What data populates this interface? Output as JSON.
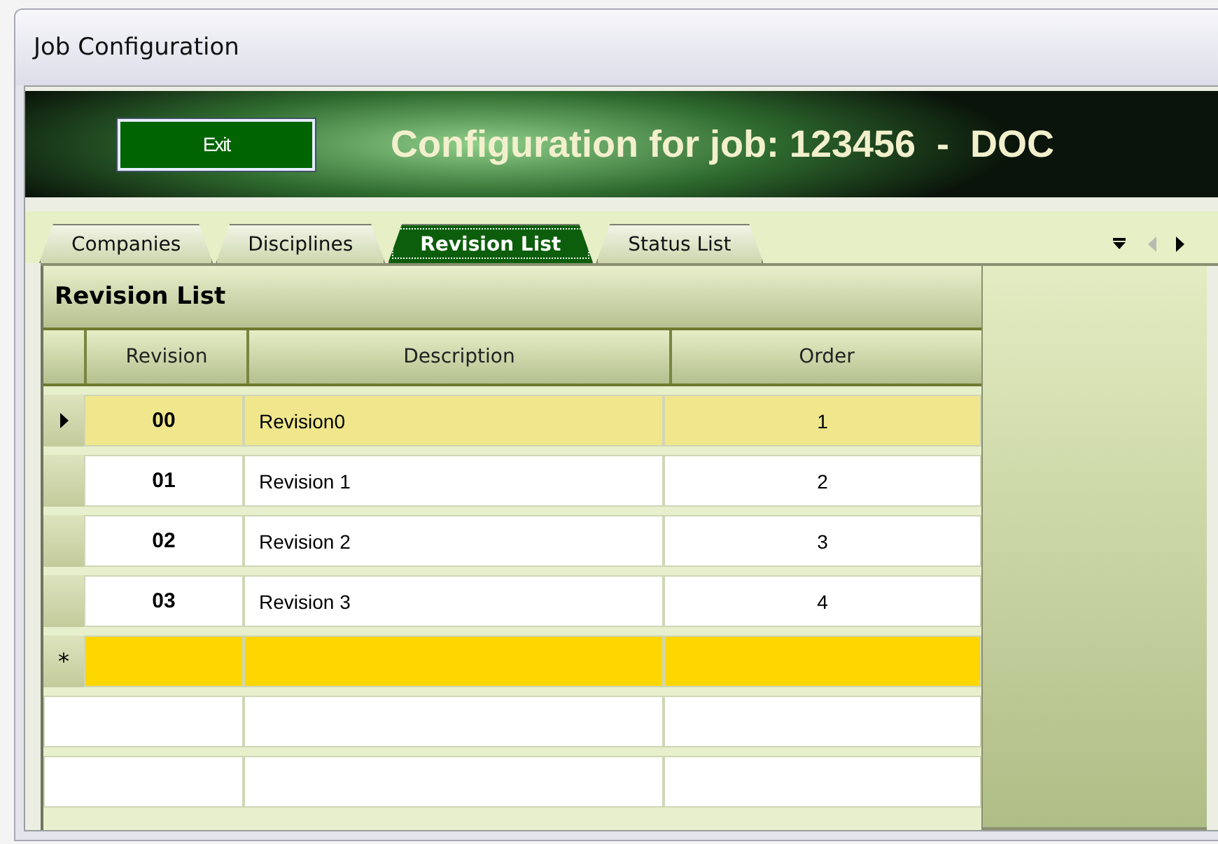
{
  "window": {
    "title": "Job Configuration"
  },
  "header": {
    "exit_button": "Exit",
    "title": "Configuration for job: 123456  -  DOC"
  },
  "tabs": [
    {
      "label": "Companies",
      "selected": false
    },
    {
      "label": "Disciplines",
      "selected": false
    },
    {
      "label": "Revision List",
      "selected": true
    },
    {
      "label": "Status List",
      "selected": false
    }
  ],
  "tab_scroll": [
    {
      "kind": "left",
      "disabled": true
    },
    {
      "kind": "right",
      "disabled": false
    }
  ],
  "grid": {
    "caption": "Revision List",
    "columns": [
      "Revision",
      "Description",
      "Order"
    ],
    "rows": [
      {
        "kind": "data",
        "selected": true,
        "cells": [
          "00",
          "Revision0",
          "1"
        ]
      },
      {
        "kind": "data",
        "selected": false,
        "cells": [
          "01",
          "Revision 1",
          "2"
        ]
      },
      {
        "kind": "data",
        "selected": false,
        "cells": [
          "02",
          "Revision 2",
          "3"
        ]
      },
      {
        "kind": "data",
        "selected": false,
        "cells": [
          "03",
          "Revision 3",
          "4"
        ]
      },
      {
        "kind": "new",
        "selected": false,
        "marker": "*"
      },
      {
        "kind": "empty",
        "selected": false
      },
      {
        "kind": "empty",
        "selected": false
      }
    ]
  }
}
